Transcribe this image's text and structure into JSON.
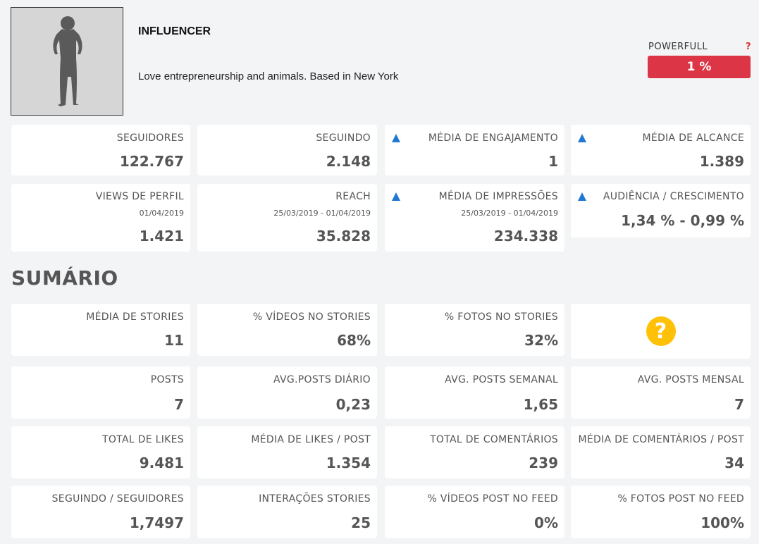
{
  "profile": {
    "name": "INFLUENCER",
    "bio": "Love entrepreneurship and animals. Based in New York"
  },
  "power": {
    "label": "POWERFULL",
    "help": "?",
    "value_text": "1 %",
    "color": "#dc3545"
  },
  "metrics": [
    {
      "label": "SEGUIDORES",
      "value": "122.767"
    },
    {
      "label": "SEGUINDO",
      "value": "2.148"
    },
    {
      "label": "MÉDIA DE ENGAJAMENTO",
      "value": "1",
      "trend_icon": "triangle-up-icon"
    },
    {
      "label": "MÉDIA DE ALCANCE",
      "value": "1.389",
      "trend_icon": "triangle-up-icon"
    },
    {
      "label": "VIEWS DE PERFIL",
      "sub": "01/04/2019",
      "value": "1.421"
    },
    {
      "label": "REACH",
      "sub": "25/03/2019 - 01/04/2019",
      "value": "35.828"
    },
    {
      "label": "MÉDIA DE IMPRESSÕES",
      "sub": "25/03/2019 - 01/04/2019",
      "value": "234.338",
      "trend_icon": "triangle-up-icon"
    },
    {
      "label": "AUDIÊNCIA / CRESCIMENTO",
      "value": "1,34 % - 0,99 %",
      "trend_icon": "triangle-up-icon"
    }
  ],
  "summary": {
    "title": "SUMÁRIO",
    "stories": [
      {
        "label": "MÉDIA DE STORIES",
        "value": "11"
      },
      {
        "label": "% VÍDEOS NO STORIES",
        "value": "68%"
      },
      {
        "label": "% FOTOS NO STORIES",
        "value": "32%"
      },
      {
        "help_icon": "question-circle-icon",
        "help_text": "?"
      }
    ],
    "posts": [
      {
        "label": "POSTS",
        "value": "7"
      },
      {
        "label": "AVG.POSTS DIÁRIO",
        "value": "0,23"
      },
      {
        "label": "AVG. POSTS SEMANAL",
        "value": "1,65"
      },
      {
        "label": "AVG. POSTS MENSAL",
        "value": "7"
      }
    ],
    "likes": [
      {
        "label": "TOTAL DE LIKES",
        "value": "9.481"
      },
      {
        "label": "MÉDIA DE LIKES / POST",
        "value": "1.354"
      },
      {
        "label": "TOTAL DE COMENTÁRIOS",
        "value": "239"
      },
      {
        "label": "MÉDIA DE COMENTÁRIOS / POST",
        "value": "34"
      }
    ],
    "ratios": [
      {
        "label": "SEGUINDO / SEGUIDORES",
        "value": "1,7497"
      },
      {
        "label": "INTERAÇÕES STORIES",
        "value": "25"
      },
      {
        "label": "% VÍDEOS POST NO FEED",
        "value": "0%"
      },
      {
        "label": "% FOTOS POST NO FEED",
        "value": "100%"
      }
    ]
  },
  "colors": {
    "trend": "#1f78d1",
    "help": "#ffc107",
    "power": "#dc3545"
  }
}
